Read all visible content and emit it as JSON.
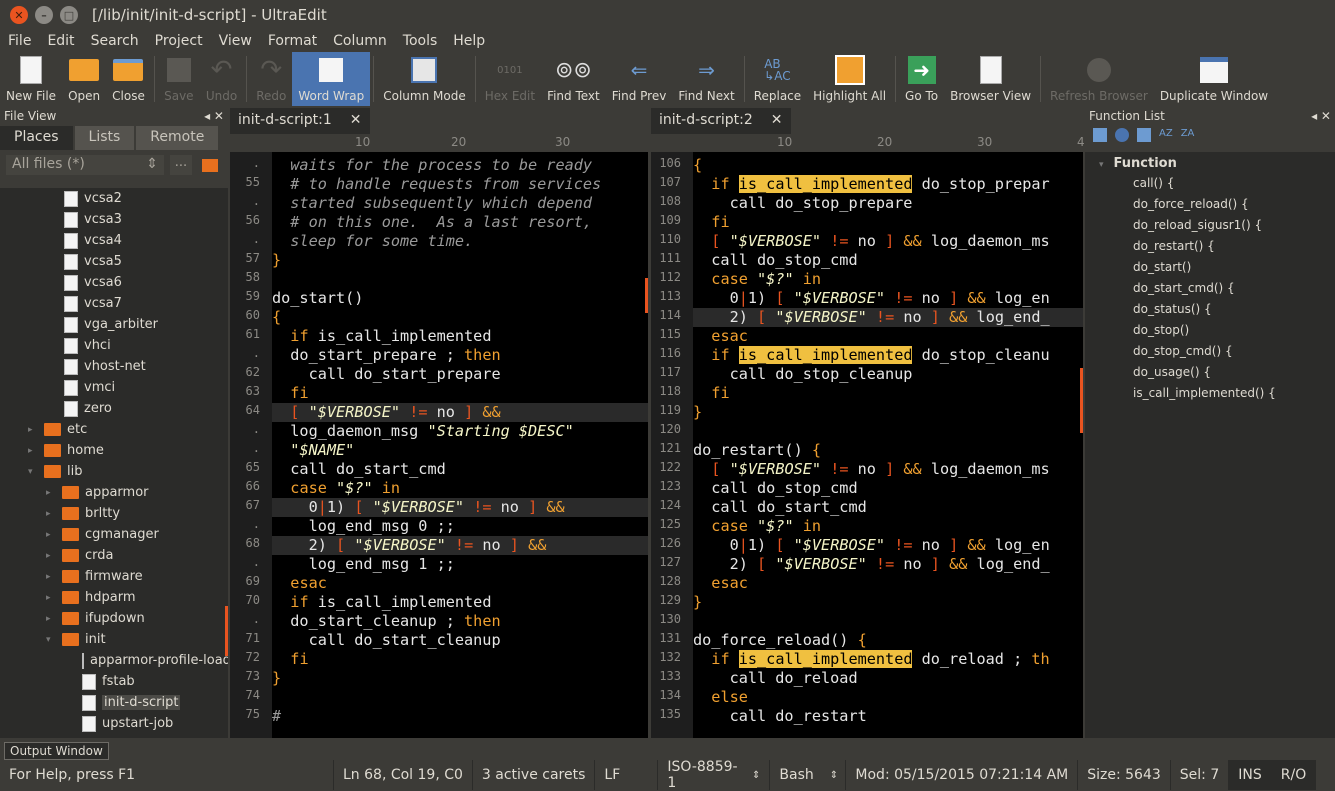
{
  "window": {
    "title": "[/lib/init/init-d-script] - UltraEdit"
  },
  "menu": [
    "File",
    "Edit",
    "Search",
    "Project",
    "View",
    "Format",
    "Column",
    "Tools",
    "Help"
  ],
  "toolbar": [
    {
      "label": "New File",
      "icon": "new-file-icon",
      "enabled": true
    },
    {
      "label": "Open",
      "icon": "open-folder-icon",
      "enabled": true
    },
    {
      "label": "Close",
      "icon": "close-folder-icon",
      "enabled": true
    },
    {
      "label": "Save",
      "icon": "save-icon",
      "enabled": false
    },
    {
      "label": "Undo",
      "icon": "undo-icon",
      "enabled": false
    },
    {
      "label": "Redo",
      "icon": "redo-icon",
      "enabled": false
    },
    {
      "label": "Word Wrap",
      "icon": "word-wrap-icon",
      "enabled": true,
      "active": true
    },
    {
      "label": "Column Mode",
      "icon": "column-mode-icon",
      "enabled": true
    },
    {
      "label": "Hex Edit",
      "icon": "hex-edit-icon",
      "enabled": false
    },
    {
      "label": "Find Text",
      "icon": "binoculars-icon",
      "enabled": true
    },
    {
      "label": "Find Prev",
      "icon": "find-prev-icon",
      "enabled": true
    },
    {
      "label": "Find Next",
      "icon": "find-next-icon",
      "enabled": true
    },
    {
      "label": "Replace",
      "icon": "replace-icon",
      "enabled": true
    },
    {
      "label": "Highlight All",
      "icon": "highlight-all-icon",
      "enabled": true
    },
    {
      "label": "Go To",
      "icon": "goto-icon",
      "enabled": true
    },
    {
      "label": "Browser View",
      "icon": "browser-view-icon",
      "enabled": true
    },
    {
      "label": "Refresh Browser",
      "icon": "refresh-browser-icon",
      "enabled": false
    },
    {
      "label": "Duplicate Window",
      "icon": "duplicate-window-icon",
      "enabled": true
    }
  ],
  "fileview": {
    "title": "File View",
    "tabs": [
      "Places",
      "Lists",
      "Remote"
    ],
    "filter": "All files (*)",
    "filter_btn": "...",
    "items": [
      {
        "name": "vcsa2",
        "type": "file",
        "depth": 2
      },
      {
        "name": "vcsa3",
        "type": "file",
        "depth": 2
      },
      {
        "name": "vcsa4",
        "type": "file",
        "depth": 2
      },
      {
        "name": "vcsa5",
        "type": "file",
        "depth": 2
      },
      {
        "name": "vcsa6",
        "type": "file",
        "depth": 2
      },
      {
        "name": "vcsa7",
        "type": "file",
        "depth": 2
      },
      {
        "name": "vga_arbiter",
        "type": "file",
        "depth": 2
      },
      {
        "name": "vhci",
        "type": "file",
        "depth": 2
      },
      {
        "name": "vhost-net",
        "type": "file",
        "depth": 2
      },
      {
        "name": "vmci",
        "type": "file",
        "depth": 2
      },
      {
        "name": "zero",
        "type": "file",
        "depth": 2
      },
      {
        "name": "etc",
        "type": "dir",
        "depth": 1,
        "arrow": "▸"
      },
      {
        "name": "home",
        "type": "dir",
        "depth": 1,
        "arrow": "▸"
      },
      {
        "name": "lib",
        "type": "dir",
        "depth": 1,
        "arrow": "▾"
      },
      {
        "name": "apparmor",
        "type": "dir",
        "depth": 2,
        "arrow": "▸"
      },
      {
        "name": "brltty",
        "type": "dir",
        "depth": 2,
        "arrow": "▸"
      },
      {
        "name": "cgmanager",
        "type": "dir",
        "depth": 2,
        "arrow": "▸"
      },
      {
        "name": "crda",
        "type": "dir",
        "depth": 2,
        "arrow": "▸"
      },
      {
        "name": "firmware",
        "type": "dir",
        "depth": 2,
        "arrow": "▸"
      },
      {
        "name": "hdparm",
        "type": "dir",
        "depth": 2,
        "arrow": "▸"
      },
      {
        "name": "ifupdown",
        "type": "dir",
        "depth": 2,
        "arrow": "▸"
      },
      {
        "name": "init",
        "type": "dir",
        "depth": 2,
        "arrow": "▾"
      },
      {
        "name": "apparmor-profile-load",
        "type": "file",
        "depth": 3
      },
      {
        "name": "fstab",
        "type": "file",
        "depth": 3
      },
      {
        "name": "init-d-script",
        "type": "file",
        "depth": 3,
        "selected": true
      },
      {
        "name": "upstart-job",
        "type": "file",
        "depth": 3
      }
    ]
  },
  "editor1": {
    "tab": "init-d-script:1",
    "ruler": [
      "10",
      "20",
      "30"
    ],
    "lines": [
      {
        "n": ".",
        "html": "<span class='cmt'>  waits for the process to be ready</span>"
      },
      {
        "n": "55",
        "html": "<span class='cmt'>  # to handle requests from services</span>"
      },
      {
        "n": ".",
        "html": "<span class='cmt'>  started subsequently which depend</span>"
      },
      {
        "n": "56",
        "html": "<span class='cmt'>  # on this one.  As a last resort,</span>"
      },
      {
        "n": ".",
        "html": "<span class='cmt'>  sleep for some time.</span>"
      },
      {
        "n": "57",
        "html": "<span class='kw'>}</span>"
      },
      {
        "n": "58",
        "html": ""
      },
      {
        "n": "59",
        "html": "do_start()"
      },
      {
        "n": "60",
        "html": "<span class='kw'>{</span>"
      },
      {
        "n": "61",
        "html": "  <span class='kw'>if</span> is_call_implemented"
      },
      {
        "n": ".",
        "html": "  do_start_prepare ; <span class='kw'>then</span>"
      },
      {
        "n": "62",
        "html": "    call do_start_prepare"
      },
      {
        "n": "63",
        "html": "  <span class='kw'>fi</span>"
      },
      {
        "n": "64",
        "cur": true,
        "html": "  <span class='op'>[</span> <span class='str'>\"$VERBOSE\"</span> <span class='op'>!=</span> no <span class='op'>]</span> <span class='kw'>&amp;&amp;</span>"
      },
      {
        "n": ".",
        "html": "  log_daemon_msg <span class='str'>\"Starting $DESC\"</span>"
      },
      {
        "n": ".",
        "html": "  <span class='str'>\"$NAME\"</span>"
      },
      {
        "n": "65",
        "html": "  call do_start_cmd"
      },
      {
        "n": "66",
        "html": "  <span class='kw'>case</span> <span class='str'>\"$?\"</span> <span class='kw'>in</span>"
      },
      {
        "n": "67",
        "cur": true,
        "html": "    0<span class='op'>|</span>1) <span class='op'>[</span> <span class='str'>\"$VERBOSE\"</span> <span class='op'>!=</span> no <span class='op'>]</span> <span class='kw'>&amp;&amp;</span>"
      },
      {
        "n": ".",
        "html": "    log_end_msg 0 ;;"
      },
      {
        "n": "68",
        "cur": true,
        "html": "    2) <span class='op'>[</span> <span class='str'>\"$VERBOSE\"</span> <span class='op'>!=</span> no <span class='op'>]</span> <span class='kw'>&amp;&amp;</span>"
      },
      {
        "n": ".",
        "html": "    log_end_msg 1 ;;"
      },
      {
        "n": "69",
        "html": "  <span class='kw'>esac</span>"
      },
      {
        "n": "70",
        "html": "  <span class='kw'>if</span> is_call_implemented"
      },
      {
        "n": ".",
        "html": "  do_start_cleanup ; <span class='kw'>then</span>"
      },
      {
        "n": "71",
        "html": "    call do_start_cleanup"
      },
      {
        "n": "72",
        "html": "  <span class='kw'>fi</span>"
      },
      {
        "n": "73",
        "html": "<span class='kw'>}</span>"
      },
      {
        "n": "74",
        "html": ""
      },
      {
        "n": "75",
        "html": "<span class='cmt'>#</span>"
      }
    ]
  },
  "editor2": {
    "tab": "init-d-script:2",
    "ruler": [
      "10",
      "20",
      "30",
      "4"
    ],
    "lines": [
      {
        "n": "106",
        "html": "<span class='kw'>{</span>"
      },
      {
        "n": "107",
        "html": "  <span class='kw'>if</span> <span class='hl'>is_call_implemented</span> do_stop_prepar"
      },
      {
        "n": "108",
        "html": "    call do_stop_prepare"
      },
      {
        "n": "109",
        "html": "  <span class='kw'>fi</span>"
      },
      {
        "n": "110",
        "html": "  <span class='op'>[</span> <span class='str'>\"$VERBOSE\"</span> <span class='op'>!=</span> no <span class='op'>]</span> <span class='kw'>&amp;&amp;</span> log_daemon_ms"
      },
      {
        "n": "111",
        "html": "  call do_stop_cmd"
      },
      {
        "n": "112",
        "html": "  <span class='kw'>case</span> <span class='str'>\"$?\"</span> <span class='kw'>in</span>"
      },
      {
        "n": "113",
        "html": "    0<span class='op'>|</span>1) <span class='op'>[</span> <span class='str'>\"$VERBOSE\"</span> <span class='op'>!=</span> no <span class='op'>]</span> <span class='kw'>&amp;&amp;</span> log_en"
      },
      {
        "n": "114",
        "cur": true,
        "html": "    2) <span class='op'>[</span> <span class='str'>\"$VERBOSE\"</span> <span class='op'>!=</span> no <span class='op'>]</span> <span class='kw'>&amp;&amp;</span> log_end_"
      },
      {
        "n": "115",
        "html": "  <span class='kw'>esac</span>"
      },
      {
        "n": "116",
        "html": "  <span class='kw'>if</span> <span class='hl'>is_call_implemented</span> do_stop_cleanu"
      },
      {
        "n": "117",
        "html": "    call do_stop_cleanup"
      },
      {
        "n": "118",
        "html": "  <span class='kw'>fi</span>"
      },
      {
        "n": "119",
        "html": "<span class='kw'>}</span>"
      },
      {
        "n": "120",
        "html": ""
      },
      {
        "n": "121",
        "html": "do_restart() <span class='kw'>{</span>"
      },
      {
        "n": "122",
        "html": "  <span class='op'>[</span> <span class='str'>\"$VERBOSE\"</span> <span class='op'>!=</span> no <span class='op'>]</span> <span class='kw'>&amp;&amp;</span> log_daemon_ms"
      },
      {
        "n": "123",
        "html": "  call do_stop_cmd"
      },
      {
        "n": "124",
        "html": "  call do_start_cmd"
      },
      {
        "n": "125",
        "html": "  <span class='kw'>case</span> <span class='str'>\"$?\"</span> <span class='kw'>in</span>"
      },
      {
        "n": "126",
        "html": "    0<span class='op'>|</span>1) <span class='op'>[</span> <span class='str'>\"$VERBOSE\"</span> <span class='op'>!=</span> no <span class='op'>]</span> <span class='kw'>&amp;&amp;</span> log_en"
      },
      {
        "n": "127",
        "html": "    2) <span class='op'>[</span> <span class='str'>\"$VERBOSE\"</span> <span class='op'>!=</span> no <span class='op'>]</span> <span class='kw'>&amp;&amp;</span> log_end_"
      },
      {
        "n": "128",
        "html": "  <span class='kw'>esac</span>"
      },
      {
        "n": "129",
        "html": "<span class='kw'>}</span>"
      },
      {
        "n": "130",
        "html": ""
      },
      {
        "n": "131",
        "html": "do_force_reload() <span class='kw'>{</span>"
      },
      {
        "n": "132",
        "html": "  <span class='kw'>if</span> <span class='hl'>is_call_implemented</span> do_reload ; <span class='kw'>th</span>"
      },
      {
        "n": "133",
        "html": "    call do_reload"
      },
      {
        "n": "134",
        "html": "  <span class='kw'>else</span>"
      },
      {
        "n": "135",
        "html": "    call do_restart"
      }
    ]
  },
  "function_list": {
    "title": "Function List",
    "group": "Function",
    "items": [
      "call() {",
      "do_force_reload() {",
      "do_reload_sigusr1() {",
      "do_restart() {",
      "do_start()",
      "do_start_cmd() {",
      "do_status() {",
      "do_stop()",
      "do_stop_cmd() {",
      "do_usage() {",
      "is_call_implemented() {"
    ]
  },
  "output_window": {
    "label": "Output Window"
  },
  "status": {
    "help": "For Help, press F1",
    "position": "Ln 68, Col 19, C0",
    "carets": "3 active carets",
    "eol": "LF",
    "encoding": "ISO-8859-1",
    "syntax": "Bash",
    "modified": "Mod: 05/15/2015 07:21:14 AM",
    "size": "Size: 5643",
    "sel": "Sel: 7",
    "ins": "INS",
    "ro": "R/O"
  }
}
